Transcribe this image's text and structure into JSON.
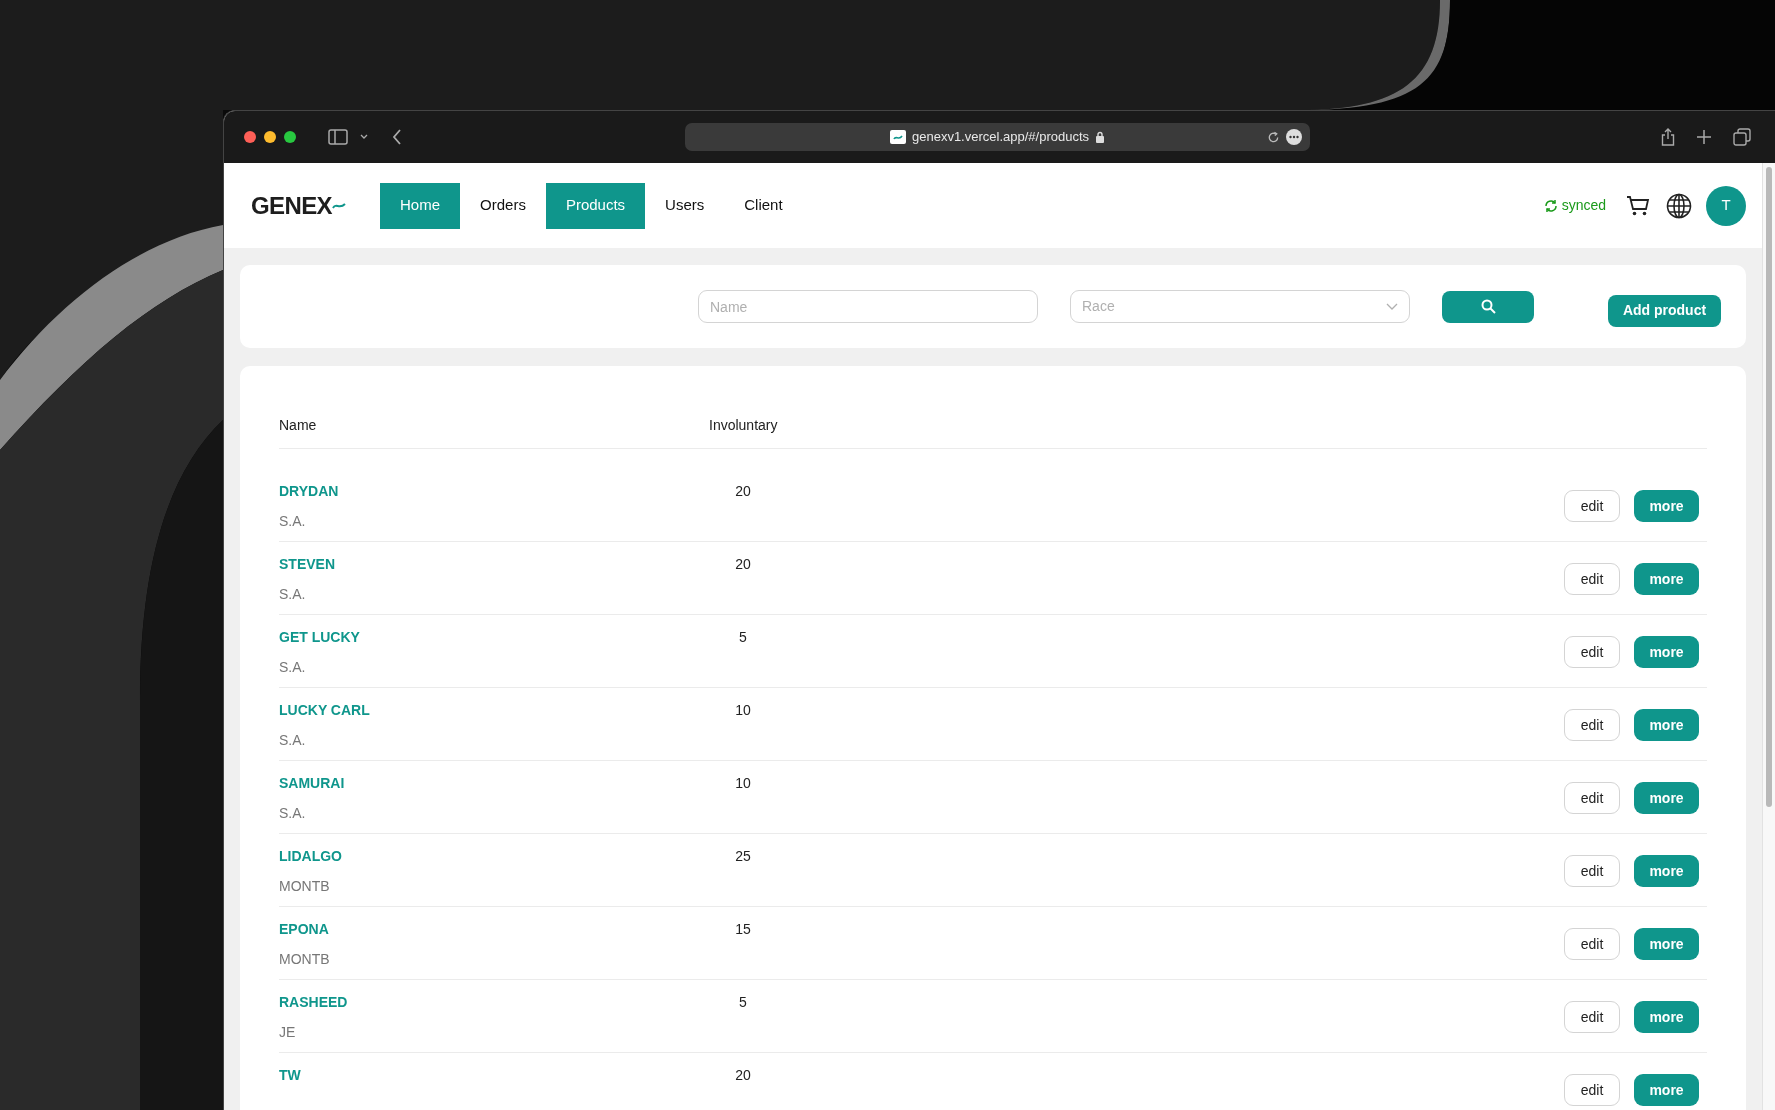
{
  "browser": {
    "url": "genexv1.vercel.app/#/products"
  },
  "app": {
    "logo": "GENEX",
    "nav": [
      {
        "label": "Home",
        "selected": true
      },
      {
        "label": "Orders",
        "selected": false
      },
      {
        "label": "Products",
        "selected": true
      },
      {
        "label": "Users",
        "selected": false
      },
      {
        "label": "Client",
        "selected": false
      }
    ],
    "sync_status": "synced",
    "avatar": "T"
  },
  "filters": {
    "name_placeholder": "Name",
    "race_placeholder": "Race",
    "add_button": "Add product"
  },
  "table": {
    "columns": [
      "Name",
      "Involuntary"
    ],
    "rows": [
      {
        "name": "DRYDAN",
        "subtitle": "S.A.",
        "involuntary": "20",
        "edit": "edit",
        "more": "more"
      },
      {
        "name": "STEVEN",
        "subtitle": "S.A.",
        "involuntary": "20",
        "edit": "edit",
        "more": "more"
      },
      {
        "name": "GET LUCKY",
        "subtitle": "S.A.",
        "involuntary": "5",
        "edit": "edit",
        "more": "more"
      },
      {
        "name": "LUCKY CARL",
        "subtitle": "S.A.",
        "involuntary": "10",
        "edit": "edit",
        "more": "more"
      },
      {
        "name": "SAMURAI",
        "subtitle": "S.A.",
        "involuntary": "10",
        "edit": "edit",
        "more": "more"
      },
      {
        "name": "LIDALGO",
        "subtitle": "MONTB",
        "involuntary": "25",
        "edit": "edit",
        "more": "more"
      },
      {
        "name": "EPONA",
        "subtitle": "MONTB",
        "involuntary": "15",
        "edit": "edit",
        "more": "more"
      },
      {
        "name": "RASHEED",
        "subtitle": "JE",
        "involuntary": "5",
        "edit": "edit",
        "more": "more"
      },
      {
        "name": "TW",
        "involuntary": "20",
        "edit": "edit",
        "more": "more"
      }
    ]
  }
}
